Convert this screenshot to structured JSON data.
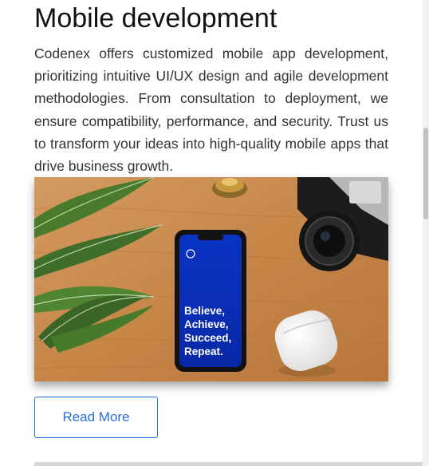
{
  "section": {
    "title": "Mobile development",
    "body": "Codenex offers customized mobile app development, prioritizing intuitive UI/UX design and agile development methodologies. From consultation to deployment, we ensure compatibility, performance, and security. Trust us to transform your ideas into high-quality mobile apps that drive business growth."
  },
  "hero_image": {
    "phone_screen_lines": [
      "Believe,",
      "Achieve,",
      "Succeed,",
      "Repeat."
    ],
    "colors": {
      "table": "#c98a4e",
      "phone_screen": "#0a2fb8",
      "plant": "#3f6d2a"
    }
  },
  "read_more": {
    "label": "Read More"
  },
  "colors": {
    "accent": "#2a6fd6",
    "text": "#333333",
    "heading": "#111111"
  }
}
